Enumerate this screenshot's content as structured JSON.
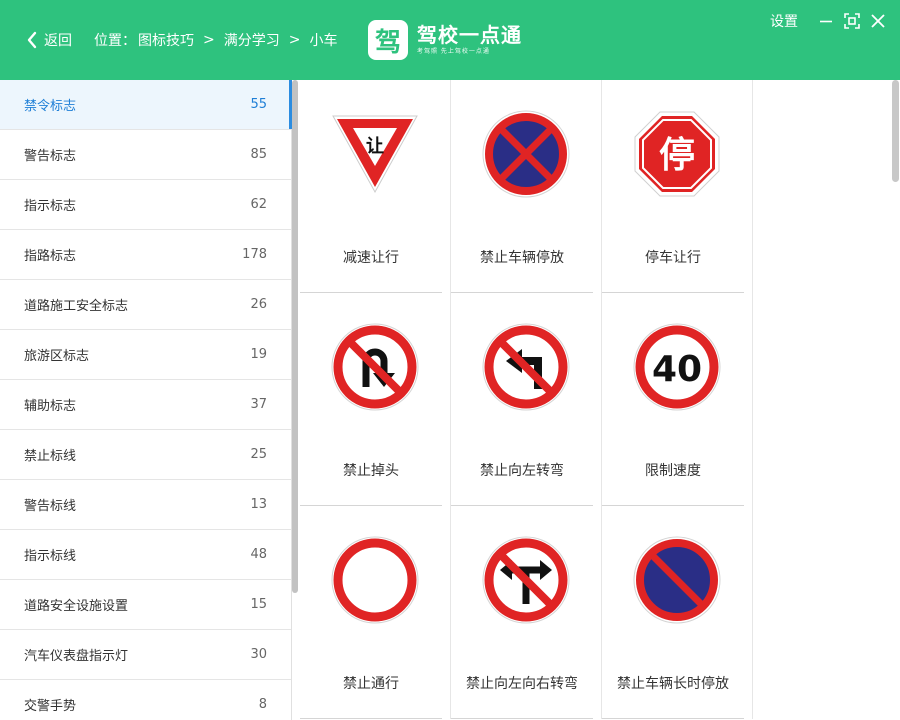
{
  "header": {
    "back_label": "返回",
    "location_label": "位置：",
    "breadcrumb": [
      "图标技巧",
      "满分学习",
      "小车"
    ],
    "separator": ">",
    "logo_mark": "驾",
    "app_name": "驾校一点通",
    "app_slogan": "考驾照 先上驾校一点通",
    "settings_label": "设置",
    "accent_color": "#2ec27e"
  },
  "sidebar": {
    "items": [
      {
        "label": "禁令标志",
        "count": "55",
        "active": true
      },
      {
        "label": "警告标志",
        "count": "85"
      },
      {
        "label": "指示标志",
        "count": "62"
      },
      {
        "label": "指路标志",
        "count": "178"
      },
      {
        "label": "道路施工安全标志",
        "count": "26"
      },
      {
        "label": "旅游区标志",
        "count": "19"
      },
      {
        "label": "辅助标志",
        "count": "37"
      },
      {
        "label": "禁止标线",
        "count": "25"
      },
      {
        "label": "警告标线",
        "count": "13"
      },
      {
        "label": "指示标线",
        "count": "48"
      },
      {
        "label": "道路安全设施设置",
        "count": "15"
      },
      {
        "label": "汽车仪表盘指示灯",
        "count": "30"
      },
      {
        "label": "交警手势",
        "count": "8"
      }
    ]
  },
  "signs": [
    {
      "label": "减速让行",
      "icon": "yield-sign-icon",
      "text": "让"
    },
    {
      "label": "禁止车辆停放",
      "icon": "no-parking-sign-icon"
    },
    {
      "label": "停车让行",
      "icon": "stop-sign-icon",
      "text": "停"
    },
    {
      "label": "禁止掉头",
      "icon": "no-u-turn-sign-icon"
    },
    {
      "label": "禁止向左转弯",
      "icon": "no-left-turn-sign-icon"
    },
    {
      "label": "限制速度",
      "icon": "speed-limit-sign-icon",
      "text": "40"
    },
    {
      "label": "禁止通行",
      "icon": "no-entry-sign-icon"
    },
    {
      "label": "禁止向左向右转弯",
      "icon": "no-left-right-turn-sign-icon"
    },
    {
      "label": "禁止车辆长时停放",
      "icon": "no-long-parking-sign-icon"
    }
  ]
}
